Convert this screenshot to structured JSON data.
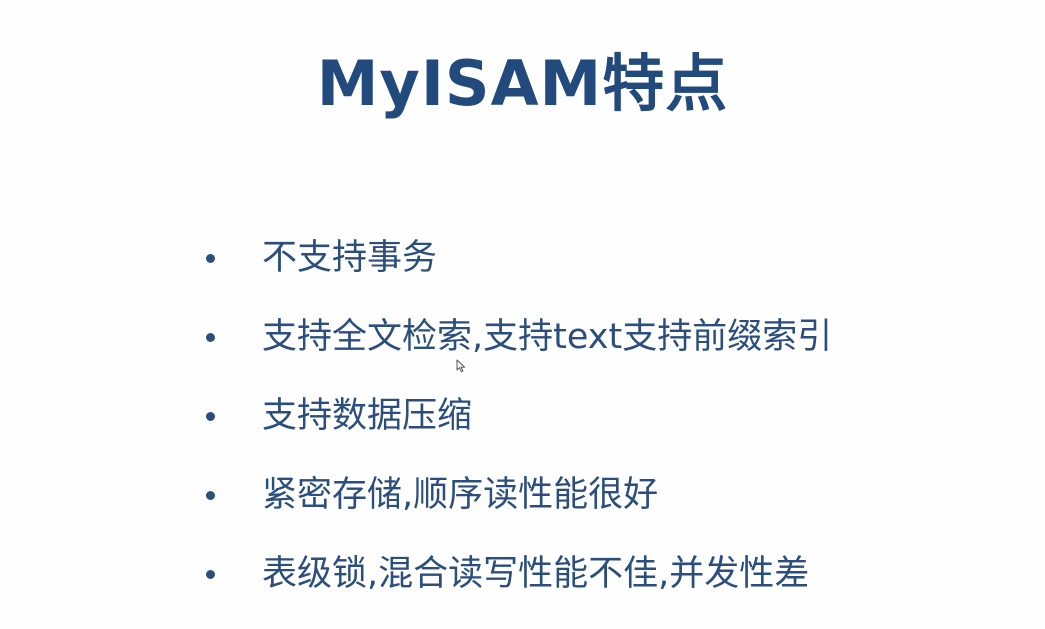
{
  "slide": {
    "title": "MyISAM特点",
    "bullets": [
      "不支持事务",
      "支持全文检索,支持text支持前缀索引",
      "支持数据压缩",
      "紧密存储,顺序读性能很好",
      "表级锁,混合读写性能不佳,并发性差"
    ]
  },
  "icons": {
    "cursor": "mouse-pointer-icon",
    "bullet": "bullet-dot-icon"
  },
  "colors": {
    "title": "#234a7c",
    "text": "#2b4e7c",
    "background": "#fefefe"
  }
}
